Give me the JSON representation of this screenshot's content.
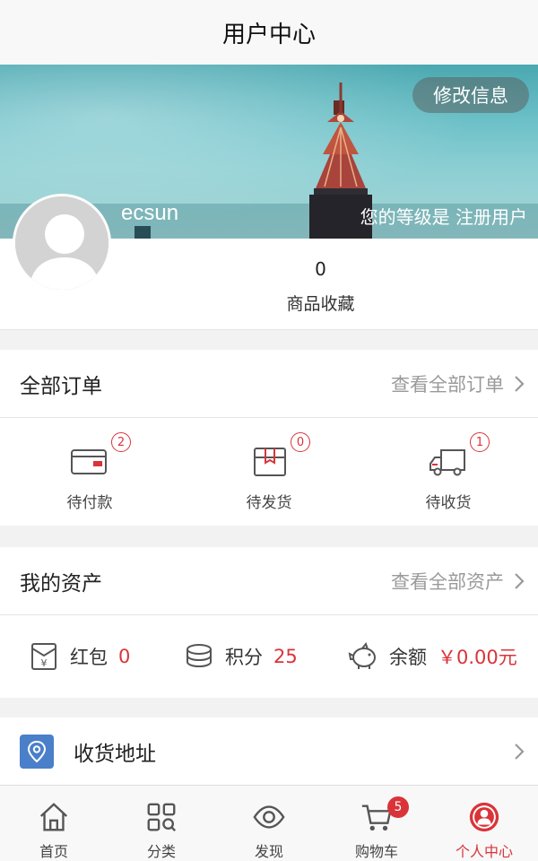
{
  "header": {
    "title": "用户中心"
  },
  "banner": {
    "edit_button": "修改信息",
    "username": "ecsun",
    "level_text": "您的等级是 注册用户"
  },
  "profile": {
    "favorites_count": "0",
    "favorites_label": "商品收藏"
  },
  "orders": {
    "title": "全部订单",
    "view_all": "查看全部订单",
    "items": [
      {
        "label": "待付款",
        "badge": "2",
        "icon": "wallet-icon"
      },
      {
        "label": "待发货",
        "badge": "0",
        "icon": "package-icon"
      },
      {
        "label": "待收货",
        "badge": "1",
        "icon": "delivery-truck-icon"
      }
    ]
  },
  "assets": {
    "title": "我的资产",
    "view_all": "查看全部资产",
    "items": [
      {
        "label": "红包",
        "value": "0",
        "icon": "red-packet-icon"
      },
      {
        "label": "积分",
        "value": "25",
        "icon": "coins-icon"
      },
      {
        "label": "余额",
        "value": "￥0.00元",
        "icon": "piggy-bank-icon"
      }
    ]
  },
  "address": {
    "label": "收货地址",
    "icon": "location-pin-icon"
  },
  "tabbar": {
    "items": [
      {
        "label": "首页",
        "icon": "home-icon"
      },
      {
        "label": "分类",
        "icon": "category-icon"
      },
      {
        "label": "发现",
        "icon": "eye-icon"
      },
      {
        "label": "购物车",
        "icon": "cart-icon",
        "badge": "5"
      },
      {
        "label": "个人中心",
        "icon": "user-icon",
        "active": true
      }
    ]
  },
  "colors": {
    "accent": "#d9343a",
    "address_icon_bg": "#4a7fc9"
  }
}
